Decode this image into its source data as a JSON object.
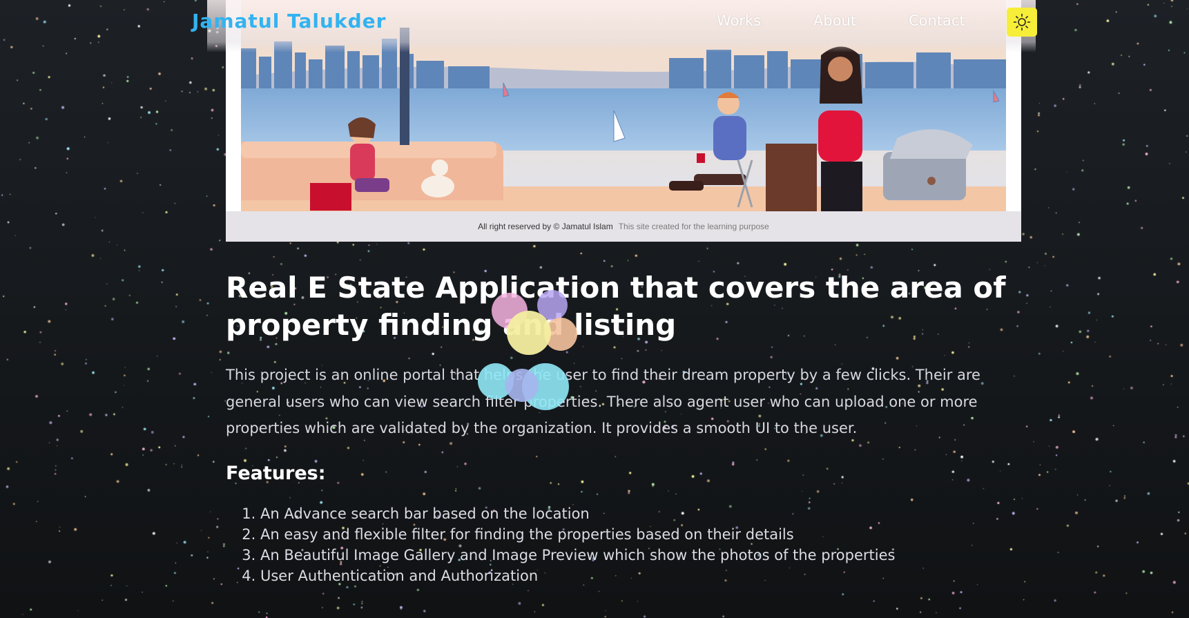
{
  "nav": {
    "brand": "Jamatul Talukder",
    "links": [
      "Works",
      "About",
      "Contact"
    ],
    "theme_toggle_icon": "sun-icon",
    "theme_toggle_color": "#f7ee3a",
    "brand_color": "#33b3f0"
  },
  "hero": {
    "footer_rights": "All right reserved by © Jamatul Islam",
    "footer_note": "This site created for the learning purpose"
  },
  "project": {
    "title": "Real E State Application that covers the area of property finding and listing",
    "description": "This project is an online portal that helps the user to find their dream property by a few clicks. Their are general users who can view search filter properties. There also agent user who can upload one or more properties which are validated by the organization. It provides a smooth UI to the user.",
    "features_heading": "Features:",
    "features": [
      "An Advance search bar based on the location",
      "An easy and flexible filter for finding the properties based on their details",
      "An Beautiful Image Gallery and Image Preview which show the photos of the properties",
      "User Authentication and Authorization"
    ]
  }
}
